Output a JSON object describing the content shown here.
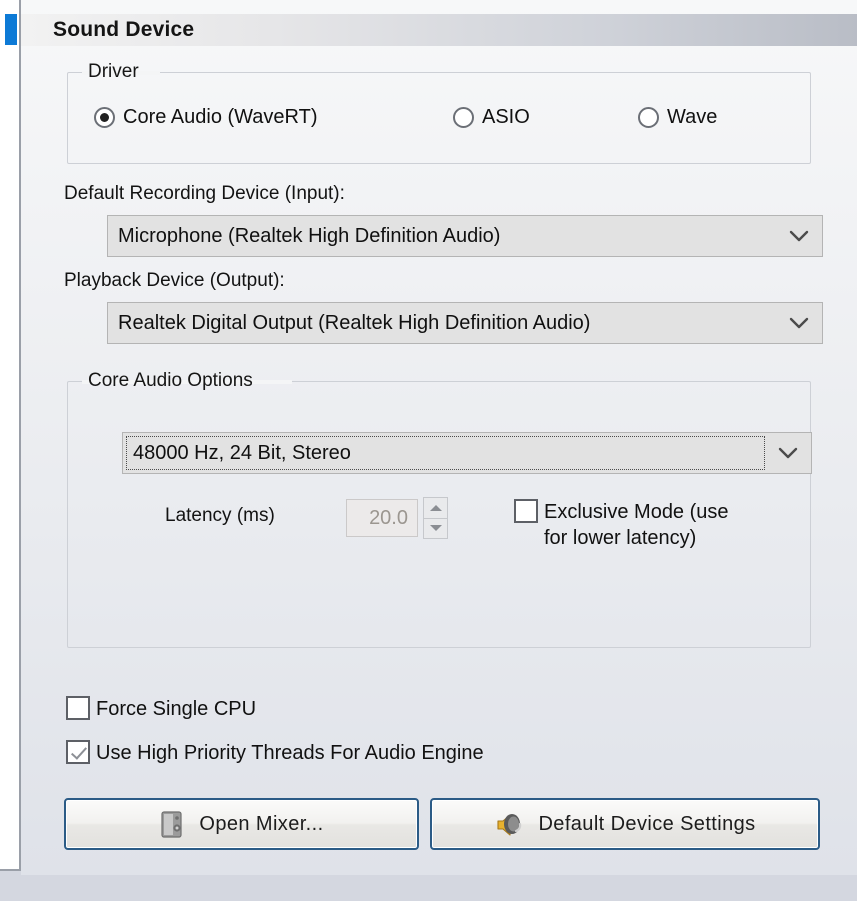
{
  "window": {
    "section_title": "Sound Device",
    "accent_color": "#0d7ad6",
    "header_gradient_from": "#f2f2f2",
    "header_gradient_to": "#b9bdc6",
    "background_color": "#d4d7e0"
  },
  "driver_group": {
    "legend": "Driver",
    "options": [
      {
        "label": "Core Audio (WaveRT)",
        "selected": true
      },
      {
        "label": "ASIO",
        "selected": false
      },
      {
        "label": "Wave",
        "selected": false
      }
    ]
  },
  "recording_device": {
    "label": "Default Recording Device (Input):",
    "value": "Microphone (Realtek High Definition Audio)",
    "chevron_icon": "chevron-down-icon"
  },
  "playback_device": {
    "label": "Playback Device (Output):",
    "value": "Realtek Digital Output (Realtek High Definition Audio)",
    "chevron_icon": "chevron-down-icon"
  },
  "core_audio_options": {
    "legend": "Core Audio Options",
    "format": {
      "value": "48000 Hz, 24 Bit, Stereo",
      "focused": true,
      "chevron_icon": "chevron-down-icon"
    },
    "latency": {
      "label": "Latency (ms)",
      "value": "20.0",
      "disabled": true,
      "up_icon": "triangle-up-icon",
      "down_icon": "triangle-down-icon"
    },
    "exclusive_mode": {
      "label_line1": "Exclusive Mode (use",
      "label_line2": "for lower latency)",
      "checked": false
    }
  },
  "options": [
    {
      "label": "Force Single CPU",
      "checked": false
    },
    {
      "label": "Use High Priority Threads For Audio Engine",
      "checked": true
    }
  ],
  "buttons": [
    {
      "label": "Open Mixer...",
      "icon": "mixer-speaker-icon"
    },
    {
      "label": "Default Device Settings",
      "icon": "speaker-horn-icon"
    }
  ]
}
